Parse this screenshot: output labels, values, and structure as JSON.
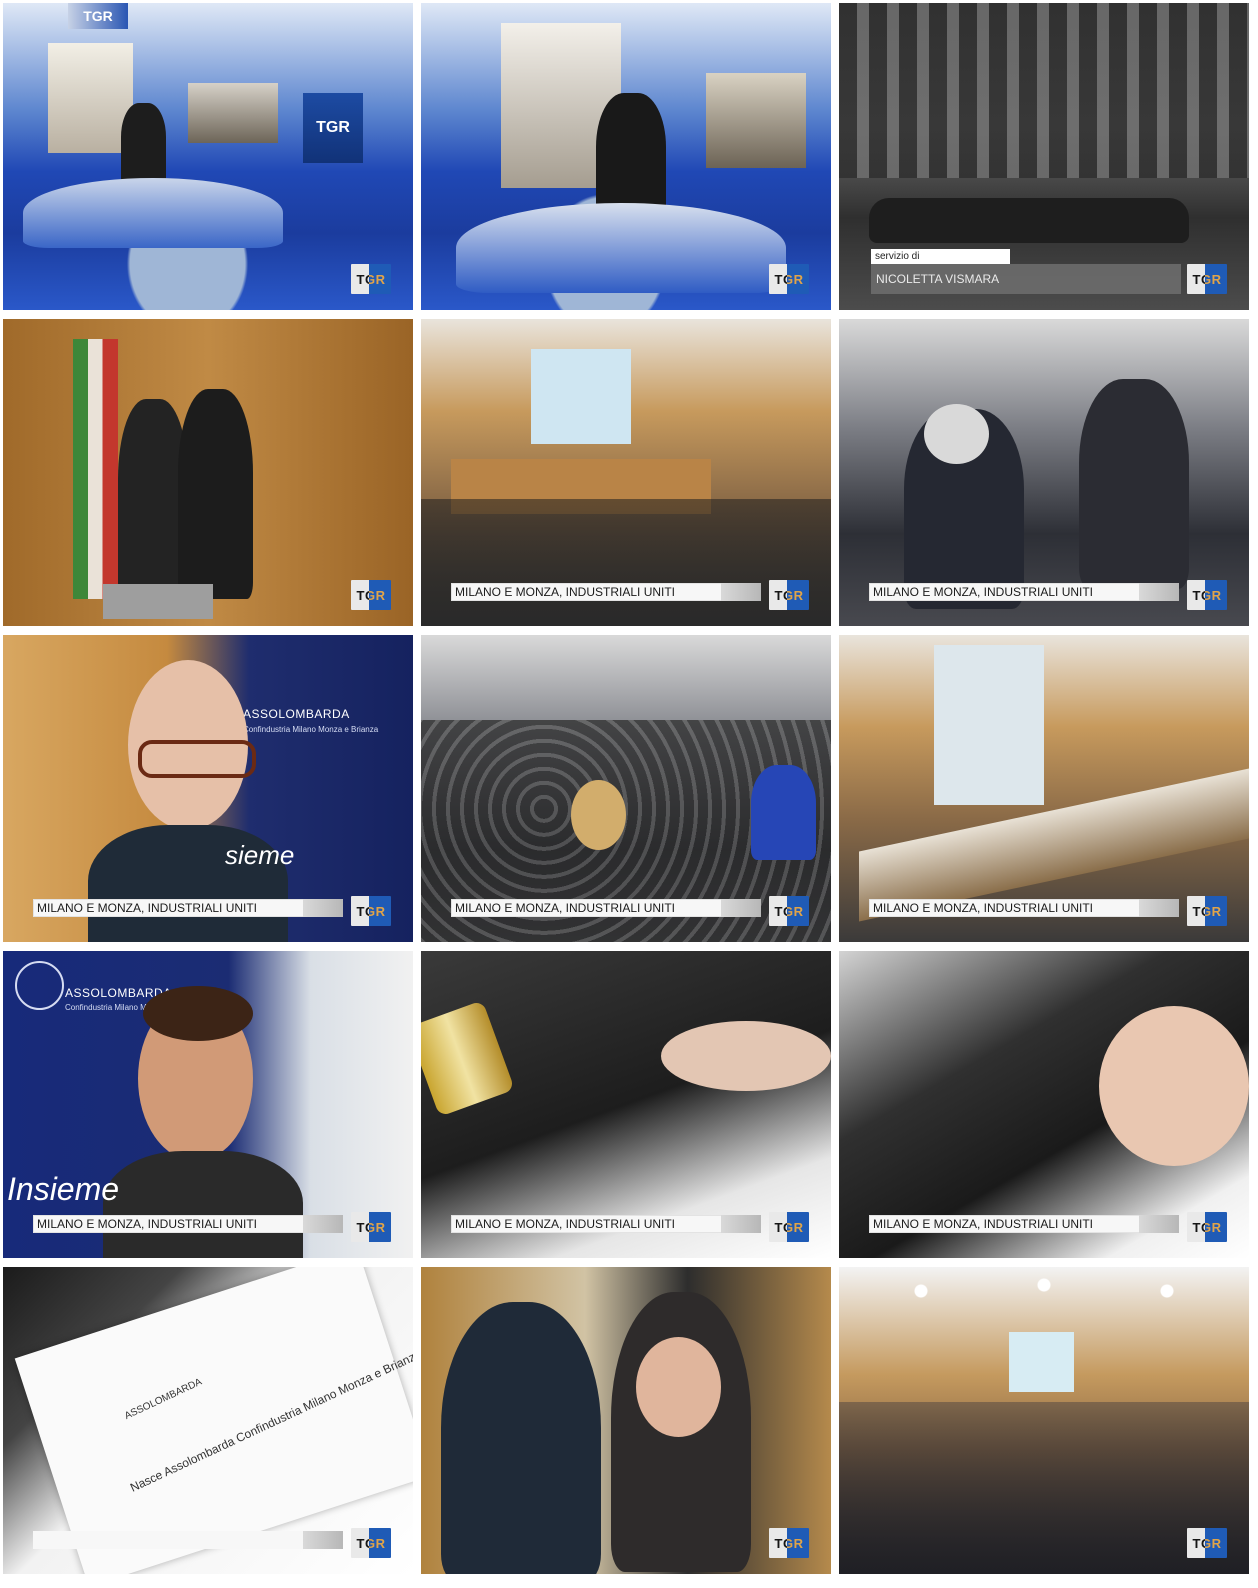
{
  "brand": {
    "channel_logo": "TGR"
  },
  "studio": {
    "logo_top": "TGR",
    "logo_screen": "TGR"
  },
  "credit": {
    "servizio_label": "servizio di",
    "reporter_name": "NICOLETTA VISMARA"
  },
  "lower_third": {
    "headline": "MILANO E MONZA, INDUSTRIALI UNITI"
  },
  "banner_text": {
    "assolombarda": "ASSOLOMBARDA",
    "assolombarda_sub": "Confindustria Milano Monza e Brianza",
    "insieme": "Insieme",
    "insieme_partial": "sieme",
    "document_line": "Nasce Assolombarda Confindustria Milano Monza e Brianza"
  },
  "frames": [
    {
      "id": 1,
      "scene": "studio"
    },
    {
      "id": 2,
      "scene": "studio"
    },
    {
      "id": 3,
      "scene": "street"
    },
    {
      "id": 4,
      "scene": "office"
    },
    {
      "id": 5,
      "scene": "hall"
    },
    {
      "id": 6,
      "scene": "crowd"
    },
    {
      "id": 7,
      "scene": "portrait"
    },
    {
      "id": 8,
      "scene": "crowd"
    },
    {
      "id": 9,
      "scene": "hall"
    },
    {
      "id": 10,
      "scene": "portrait"
    },
    {
      "id": 11,
      "scene": "cloth"
    },
    {
      "id": 12,
      "scene": "cloth"
    },
    {
      "id": 13,
      "scene": "paper"
    },
    {
      "id": 14,
      "scene": "table"
    },
    {
      "id": 15,
      "scene": "room"
    }
  ],
  "colors": {
    "tgr_blue": "#1f5bb6",
    "studio_blue": "#2048b5",
    "lower_third_bg": "#f7f7f7"
  }
}
